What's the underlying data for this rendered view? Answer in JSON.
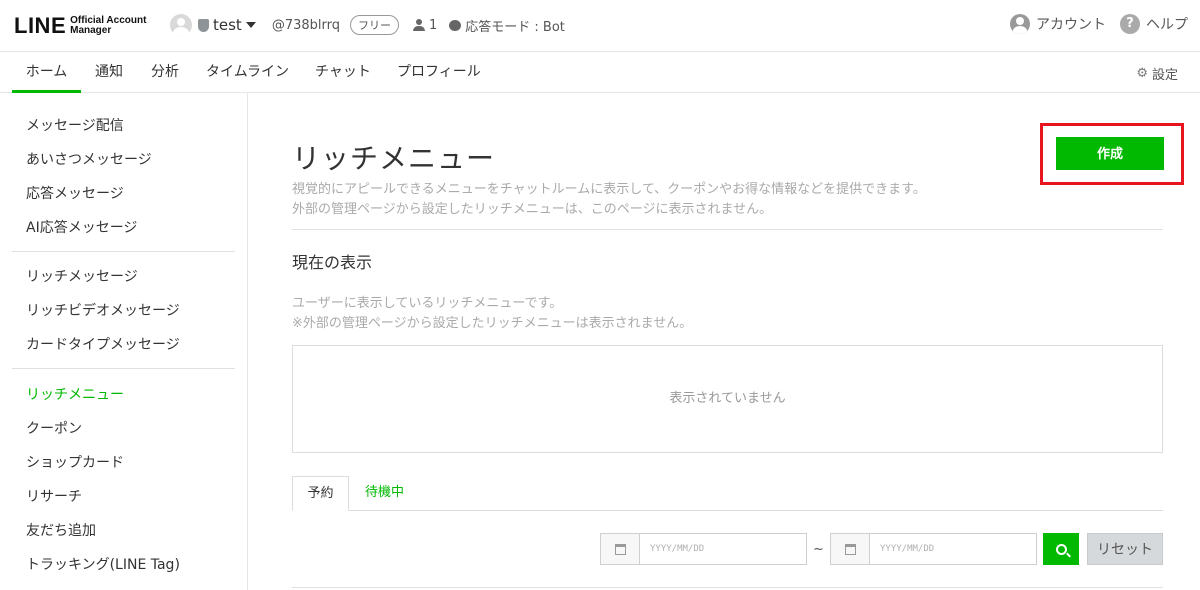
{
  "header": {
    "logo_main": "LINE",
    "logo_sub_1": "Official Account",
    "logo_sub_2": "Manager",
    "account_name": "test",
    "account_id": "@738blrrq",
    "plan_badge": "フリー",
    "friend_count": "1",
    "response_mode": "応答モード : Bot",
    "account_link": "アカウント",
    "help_link": "ヘルプ"
  },
  "nav": {
    "tabs": [
      {
        "label": "ホーム",
        "active": true
      },
      {
        "label": "通知"
      },
      {
        "label": "分析"
      },
      {
        "label": "タイムライン"
      },
      {
        "label": "チャット"
      },
      {
        "label": "プロフィール"
      }
    ],
    "settings_label": "設定"
  },
  "sidebar": {
    "items": [
      {
        "label": "メッセージ配信"
      },
      {
        "label": "あいさつメッセージ"
      },
      {
        "label": "応答メッセージ"
      },
      {
        "label": "AI応答メッセージ"
      },
      {
        "label": "リッチメッセージ"
      },
      {
        "label": "リッチビデオメッセージ"
      },
      {
        "label": "カードタイプメッセージ"
      },
      {
        "label": "リッチメニュー",
        "active": true
      },
      {
        "label": "クーポン"
      },
      {
        "label": "ショップカード"
      },
      {
        "label": "リサーチ"
      },
      {
        "label": "友だち追加"
      },
      {
        "label": "トラッキング(LINE Tag)"
      }
    ]
  },
  "main": {
    "title": "リッチメニュー",
    "description_1": "視覚的にアピールできるメニューをチャットルームに表示して、クーポンやお得な情報などを提供できます。",
    "description_2": "外部の管理ページから設定したリッチメニューは、このページに表示されません。",
    "create_label": "作成",
    "section_title": "現在の表示",
    "section_desc_1": "ユーザーに表示しているリッチメニューです。",
    "section_desc_2": "※外部の管理ページから設定したリッチメニューは表示されません。",
    "empty_text": "表示されていません",
    "tabs": [
      {
        "label": "予約",
        "active": true
      },
      {
        "label": "待機中"
      }
    ],
    "date_from_placeholder": "YYYY/MM/DD",
    "date_to_placeholder": "YYYY/MM/DD",
    "date_separator": "~",
    "reset_label": "リセット"
  },
  "colors": {
    "brand_green": "#00b900",
    "highlight_red": "#e8141e"
  }
}
